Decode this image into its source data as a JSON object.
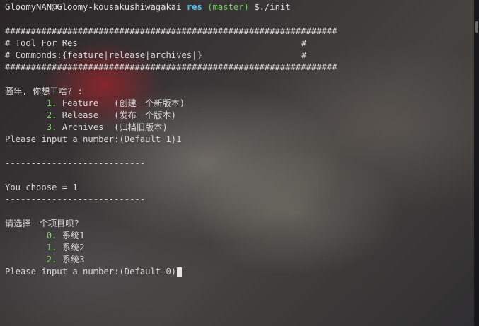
{
  "prompt": {
    "user_host": "GloomyNAN@Gloomy-kousakushiwagakai",
    "directory": "res",
    "branch": "(master)",
    "command": "$./init"
  },
  "banner": {
    "border": "################################################################",
    "line1_text": "# Tool For Res",
    "line1_end": "#",
    "line2_text": "# Commonds:{feature|release|archives|}",
    "line2_end": "#"
  },
  "menu1": {
    "question": "骚年, 你想干啥? :",
    "options": [
      {
        "num": "1.",
        "label": " Feature   (创建一个新版本)"
      },
      {
        "num": "2.",
        "label": " Release   (发布一个版本)"
      },
      {
        "num": "3.",
        "label": " Archives  (归档旧版本)"
      }
    ],
    "input_prompt": "Please input a number:(Default 1)1"
  },
  "result": {
    "separator": "---------------------------",
    "text": "You choose = 1"
  },
  "menu2": {
    "question": "请选择一个项目呗?",
    "options": [
      {
        "num": "0.",
        "label": " 系统1"
      },
      {
        "num": "1.",
        "label": " 系统2"
      },
      {
        "num": "2.",
        "label": " 系统3"
      }
    ],
    "input_prompt": "Please input a number:(Default 0)"
  }
}
